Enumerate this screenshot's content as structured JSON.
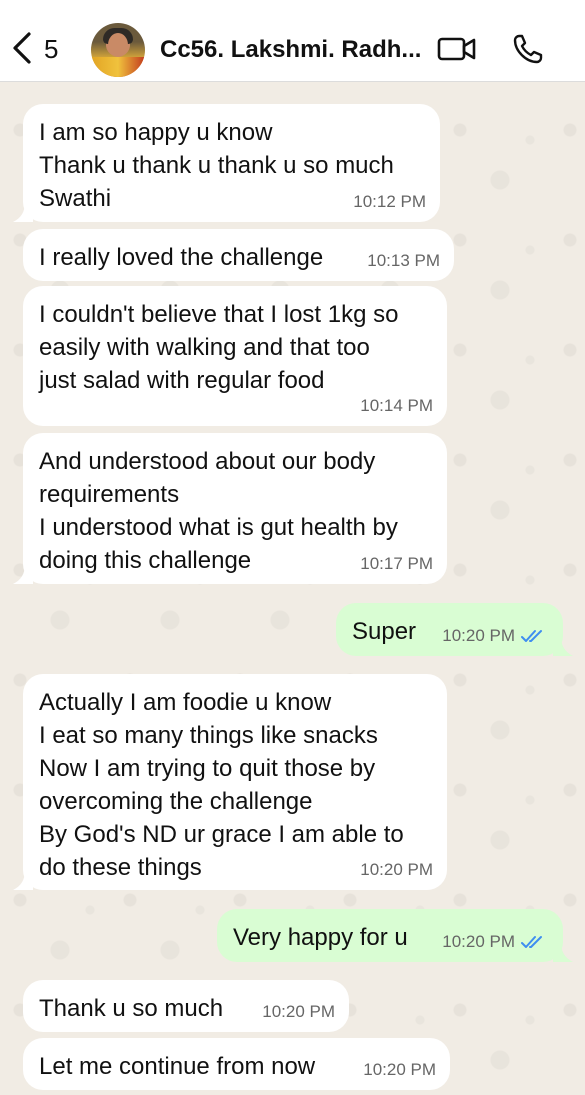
{
  "header": {
    "back_count": "5",
    "contact_name": "Cc56. Lakshmi. Radh...",
    "back_icon": "chevron-left-icon",
    "video_icon": "video-camera-icon",
    "call_icon": "phone-icon"
  },
  "colors": {
    "incoming_bubble": "#ffffff",
    "outgoing_bubble": "#d9fdd3",
    "read_ticks": "#3f8ef0",
    "wallpaper": "#efeae2"
  },
  "messages": [
    {
      "direction": "in",
      "text": "I am so happy u know\nThank u thank u thank u so much\nSwathi",
      "time": "10:12 PM"
    },
    {
      "direction": "in",
      "text": "I really loved the challenge",
      "time": "10:13 PM"
    },
    {
      "direction": "in",
      "text": "I couldn't believe that I lost 1kg so\neasily with walking and that too\njust salad with regular food",
      "time": "10:14 PM"
    },
    {
      "direction": "in",
      "text": "And understood about our body\nrequirements\nI understood what is gut health by\ndoing this challenge",
      "time": "10:17 PM"
    },
    {
      "direction": "out",
      "text": "Super",
      "time": "10:20 PM",
      "status": "read"
    },
    {
      "direction": "in",
      "text": "Actually I am foodie u know\nI eat so many things like snacks\nNow I am trying to quit those by\novercoming the challenge\nBy God's ND ur grace I am able to\ndo these things",
      "time": "10:20 PM"
    },
    {
      "direction": "out",
      "text": "Very happy for u",
      "time": "10:20 PM",
      "status": "read"
    },
    {
      "direction": "in",
      "text": "Thank u so much",
      "time": "10:20 PM"
    },
    {
      "direction": "in",
      "text": "Let me continue from now",
      "time": "10:20 PM"
    }
  ]
}
